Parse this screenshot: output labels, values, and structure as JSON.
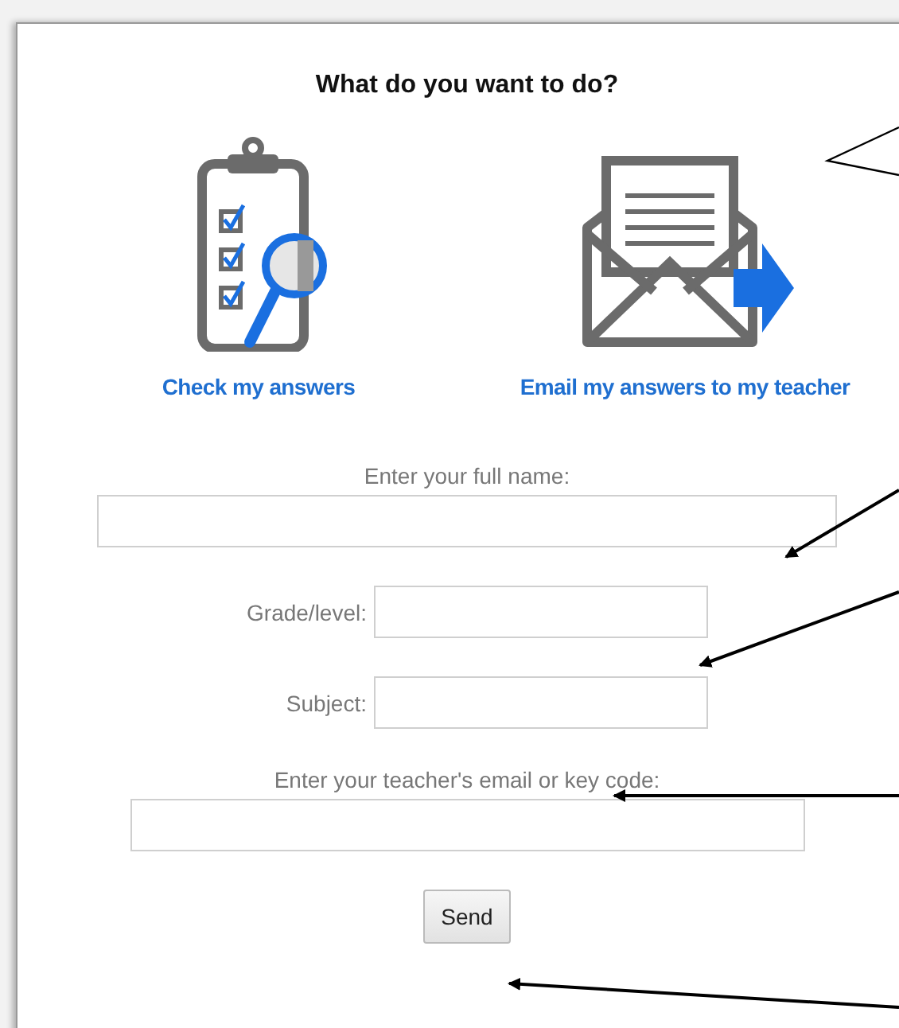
{
  "heading": "What do you want to do?",
  "options": [
    {
      "kind": "check",
      "label": "Check my answers"
    },
    {
      "kind": "email",
      "label": "Email my answers to my teacher"
    }
  ],
  "fields": [
    {
      "kind": "stacked-wide",
      "label": "Enter your full name:"
    },
    {
      "kind": "inline",
      "label": "Grade/level:"
    },
    {
      "kind": "inline",
      "label": "Subject:"
    },
    {
      "kind": "stacked",
      "label": "Enter your teacher's email or key code:"
    }
  ],
  "button": "Send"
}
